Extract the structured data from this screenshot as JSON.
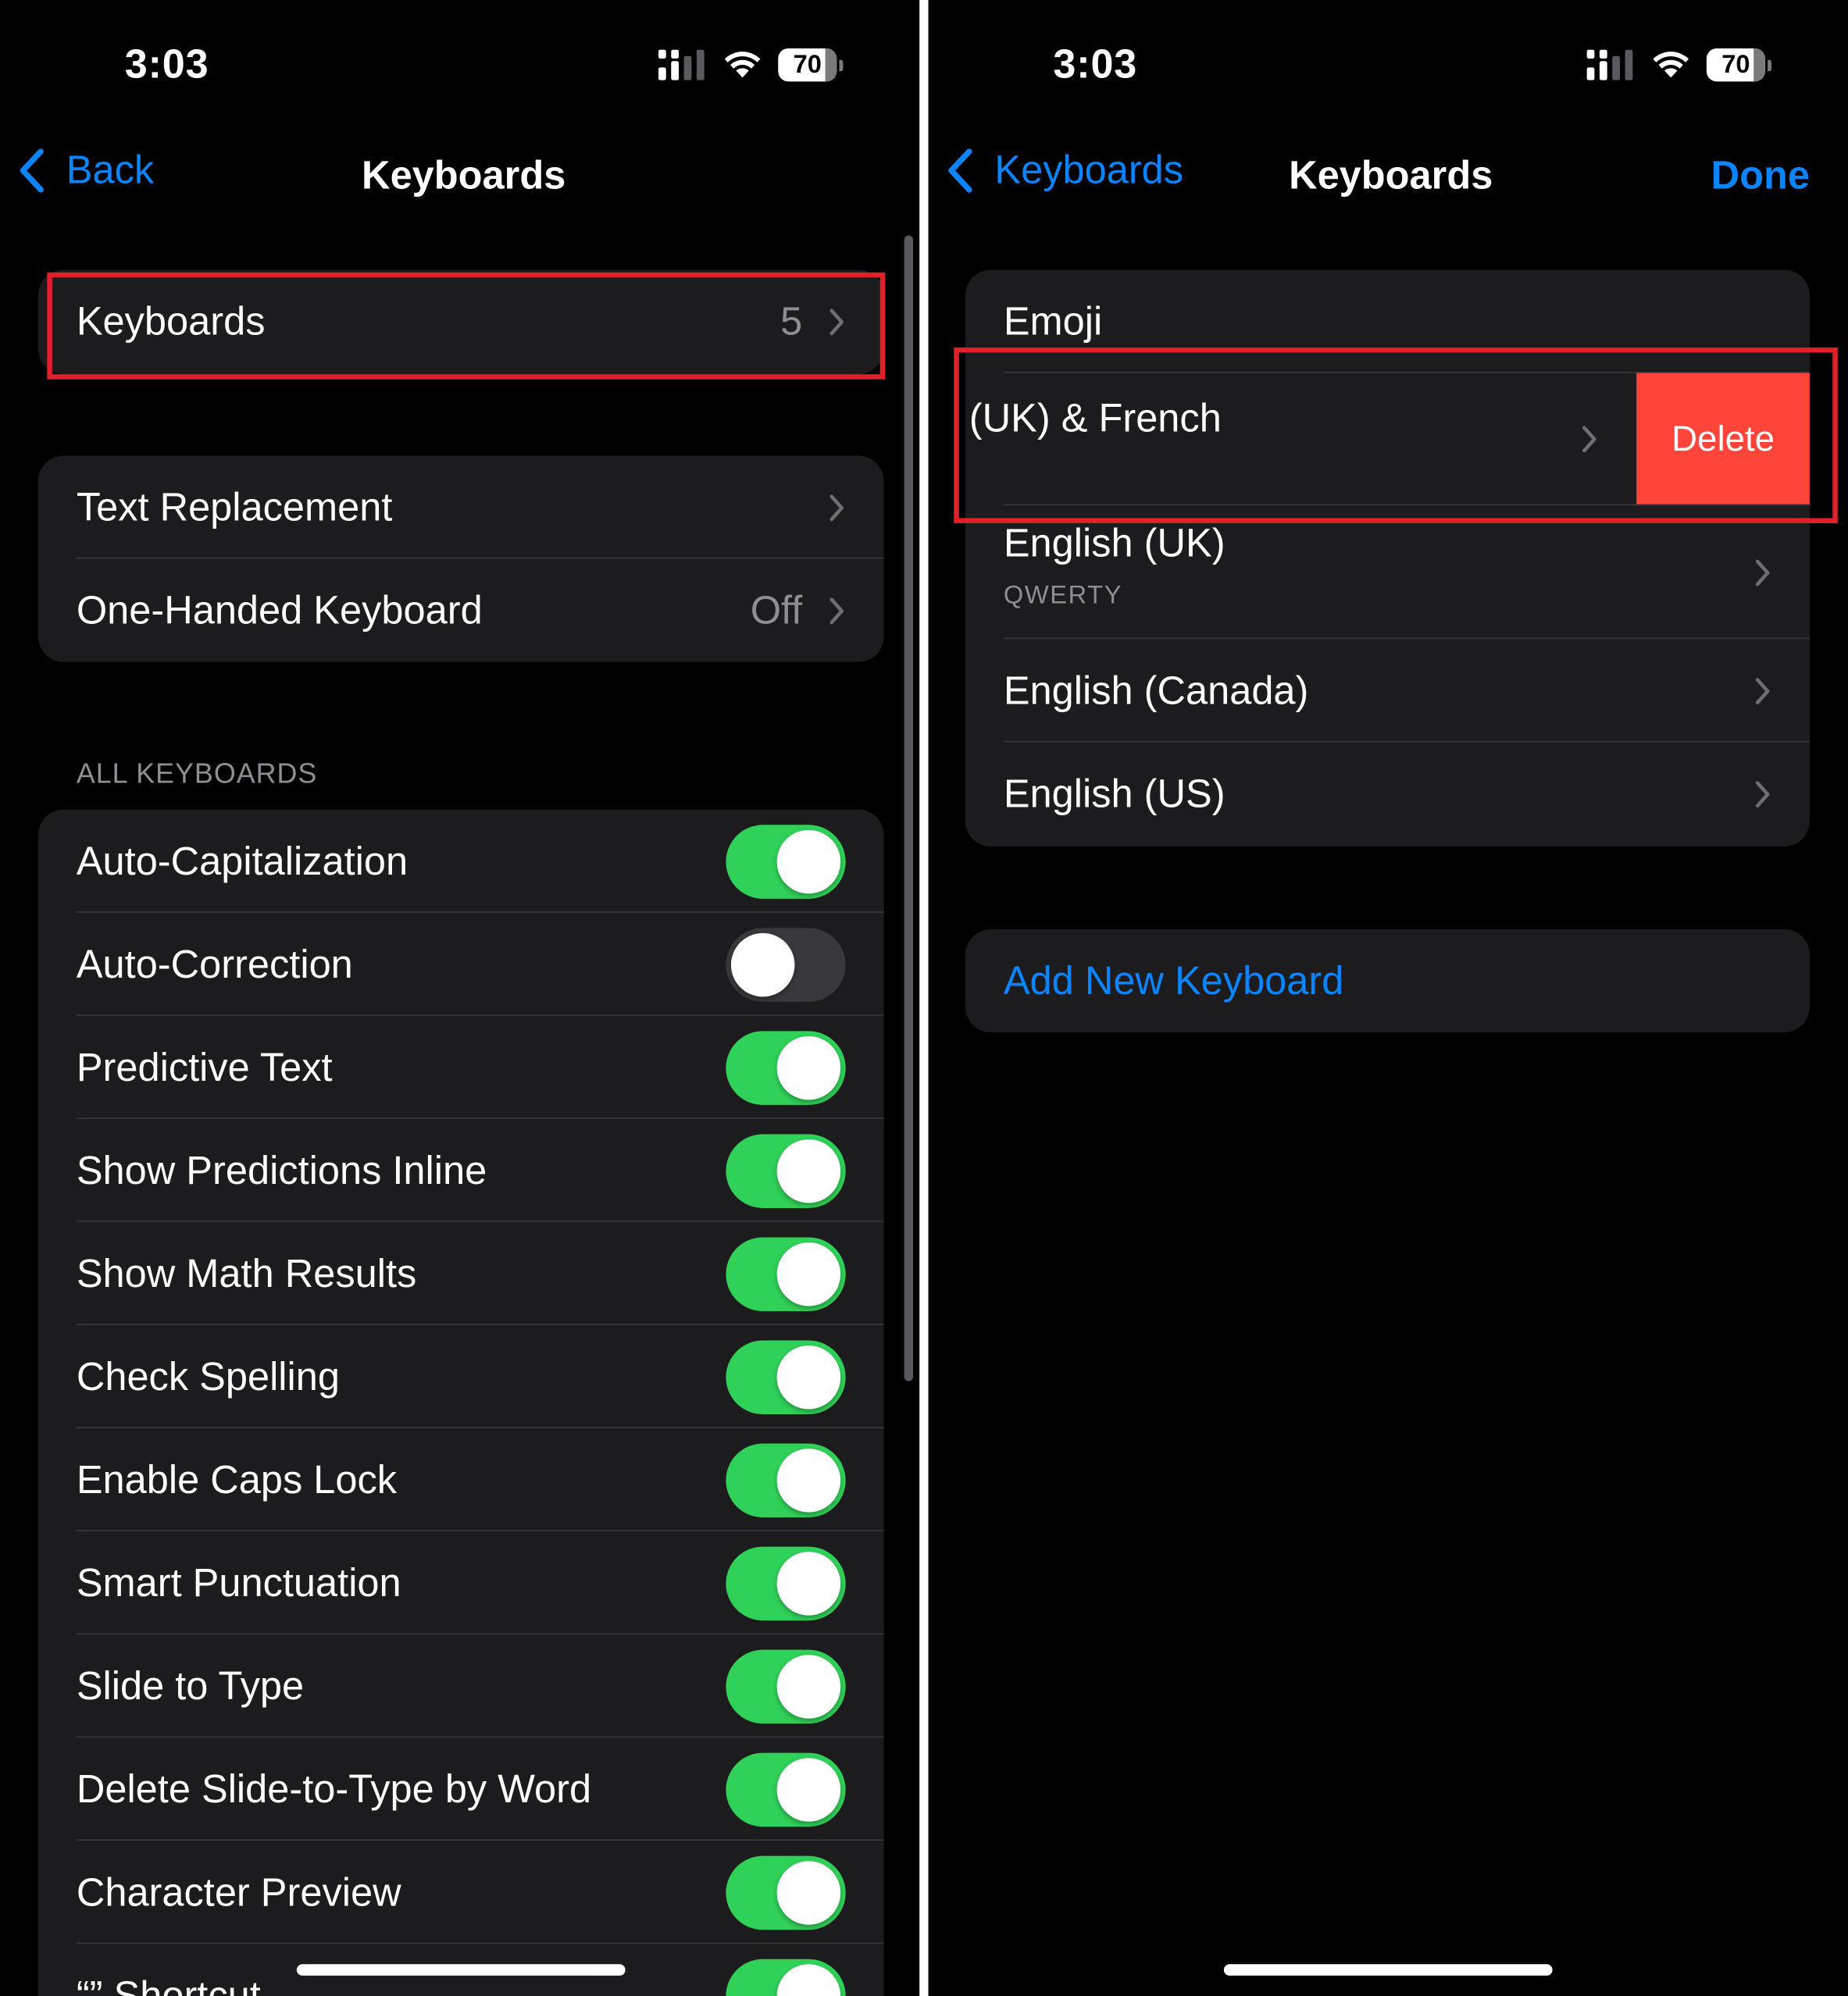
{
  "status_bar": {
    "time": "3:03",
    "battery_percent": "70",
    "icons": [
      "cellular-signal-icon",
      "wifi-icon",
      "battery-icon"
    ]
  },
  "left_screen": {
    "nav": {
      "back_label": "Back",
      "title": "Keyboards"
    },
    "keyboards_row": {
      "label": "Keyboards",
      "count": "5"
    },
    "settings_group": [
      {
        "label": "Text Replacement",
        "value": ""
      },
      {
        "label": "One-Handed Keyboard",
        "value": "Off"
      }
    ],
    "all_keyboards_header": "ALL KEYBOARDS",
    "toggles": [
      {
        "label": "Auto-Capitalization",
        "on": true
      },
      {
        "label": "Auto-Correction",
        "on": false
      },
      {
        "label": "Predictive Text",
        "on": true
      },
      {
        "label": "Show Predictions Inline",
        "on": true
      },
      {
        "label": "Show Math Results",
        "on": true
      },
      {
        "label": "Check Spelling",
        "on": true
      },
      {
        "label": "Enable Caps Lock",
        "on": true
      },
      {
        "label": "Smart Punctuation",
        "on": true
      },
      {
        "label": "Slide to Type",
        "on": true
      },
      {
        "label": "Delete Slide-to-Type by Word",
        "on": true
      },
      {
        "label": "Character Preview",
        "on": true
      },
      {
        "label": "“” Shortcut",
        "on": true
      }
    ]
  },
  "right_screen": {
    "nav": {
      "back_label": "Keyboards",
      "title": "Keyboards",
      "done_label": "Done"
    },
    "keyboards": [
      {
        "label": "Emoji",
        "sublabel": ""
      },
      {
        "label": "(UK) & French",
        "sublabel": "",
        "swiped": true,
        "action_label": "Delete"
      },
      {
        "label": "English (UK)",
        "sublabel": "QWERTY"
      },
      {
        "label": "English (Canada)",
        "sublabel": ""
      },
      {
        "label": "English (US)",
        "sublabel": ""
      }
    ],
    "add_new_keyboard": "Add New Keyboard"
  },
  "colors": {
    "accent": "#0a84ff",
    "toggle_on": "#30d158",
    "toggle_off": "#39393d",
    "delete": "#ff453a",
    "highlight": "#e0202a",
    "cell_background": "#1c1c1e",
    "secondary_text": "#8e8e93"
  }
}
